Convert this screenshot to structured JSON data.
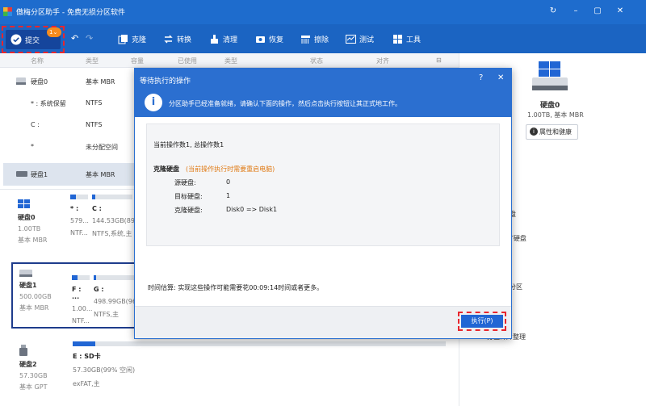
{
  "window": {
    "title": "傲梅分区助手 - 免费无损分区软件",
    "controls": [
      "↻",
      "–",
      "▢",
      "✕"
    ]
  },
  "toolbar": {
    "commit_label": "提交",
    "commit_badge": "1",
    "items": [
      {
        "label": "克隆",
        "icon": "clone-icon"
      },
      {
        "label": "转换",
        "icon": "convert-icon"
      },
      {
        "label": "清理",
        "icon": "clean-icon"
      },
      {
        "label": "恢复",
        "icon": "recover-icon"
      },
      {
        "label": "擦除",
        "icon": "wipe-icon"
      },
      {
        "label": "测试",
        "icon": "test-icon"
      },
      {
        "label": "工具",
        "icon": "tools-icon"
      }
    ]
  },
  "table": {
    "columns": [
      "名称",
      "类型",
      "容量",
      "已使用",
      "类型",
      "状态",
      "对齐"
    ],
    "rows": [
      {
        "name": "硬盘0",
        "type": "基本 MBR"
      },
      {
        "name": "* : 系统保留",
        "type": "NTFS"
      },
      {
        "name": "C :",
        "type": "NTFS"
      },
      {
        "name": "*",
        "type": "未分配空间"
      },
      {
        "name": "硬盘1",
        "type": "基本 MBR"
      }
    ]
  },
  "disks": [
    {
      "name": "硬盘0",
      "size": "1.00TB",
      "type": "基本 MBR",
      "parts": [
        {
          "name": "* :",
          "size": "579...",
          "fs": "NTF...",
          "used": 0.3
        },
        {
          "name": "C :",
          "size": "144.53GB(89%",
          "fs": "NTFS,系统,主",
          "used": 0.08
        }
      ]
    },
    {
      "name": "硬盘1",
      "size": "500.00GB",
      "type": "基本 MBR",
      "parts": [
        {
          "name": "F : ...",
          "size": "1.00...",
          "fs": "NTF...",
          "used": 0.3
        },
        {
          "name": "G :",
          "size": "498.99GB(96%",
          "fs": "NTFS,主",
          "used": 0.06
        }
      ]
    },
    {
      "name": "硬盘2",
      "size": "57.30GB",
      "type": "基本 GPT",
      "parts": [
        {
          "name": "E : SD卡",
          "size": "57.30GB(99% 空闲)",
          "fs": "exFAT,主",
          "used": 0.01
        }
      ]
    }
  ],
  "right_panel": {
    "disk_label": "硬盘0",
    "disk_meta": "1.00TB, 基本 MBR",
    "props_button": "属性和健康",
    "partial_items": [
      "盘",
      "T硬盘",
      "分区",
      "分区碎片整理"
    ]
  },
  "dialog": {
    "title": "等待执行的操作",
    "help": "?",
    "close": "✕",
    "info": "分区助手已经准备就绪，请确认下面的操作，然后点击执行按钮让其正式地工作。",
    "summary": "当前操作数1, 总操作数1",
    "op_title": "克隆硬盘",
    "op_note": "(当前操作执行时需要重启电脑)",
    "src_label": "源硬盘:",
    "src_value": "0",
    "dst_label": "目标硬盘:",
    "dst_value": "1",
    "clone_label": "克隆硬盘:",
    "clone_value": "Disk0 => Disk1",
    "time_estimate": "时间估算: 实现这些操作可能需要花00:09:14时间或者更多。",
    "execute_button": "执行(P)"
  },
  "colors": {
    "titlebar": "#1e6ccd",
    "toolbar": "#1b64c2",
    "accent": "#2166d4",
    "warning": "#e8262d",
    "badge": "#f58b1e"
  }
}
